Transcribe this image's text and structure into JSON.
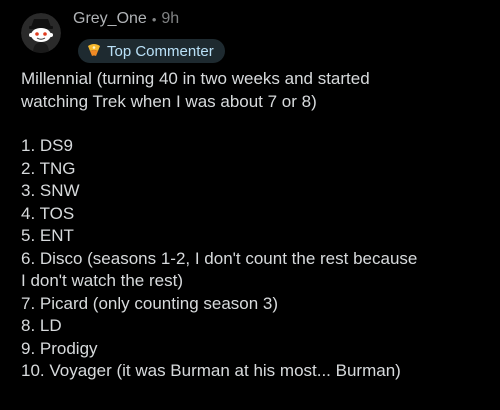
{
  "comment": {
    "author": "Grey_One",
    "separator": "•",
    "time": "9h",
    "badge": {
      "label": "Top Commenter",
      "icon": "trophy-icon",
      "background": "#1e2a30",
      "text_color": "#b9e0f7"
    },
    "avatar_icon": "snoo-avatar-icon",
    "intro_line1": "Millennial (turning 40 in two weeks and started",
    "intro_line2": "watching Trek when I was about 7 or 8)",
    "list": [
      "1. DS9",
      "2. TNG",
      "3. SNW",
      "4. TOS",
      "5. ENT",
      "6. Disco (seasons 1-2, I don't count the rest because",
      "I don't watch the rest)",
      "7. Picard (only counting season 3)",
      "8. LD",
      "9. Prodigy",
      "10. Voyager (it was Burman at his most... Burman)"
    ]
  },
  "colors": {
    "background": "#000000",
    "body_text": "#d7dadc",
    "meta_text": "#818384"
  }
}
